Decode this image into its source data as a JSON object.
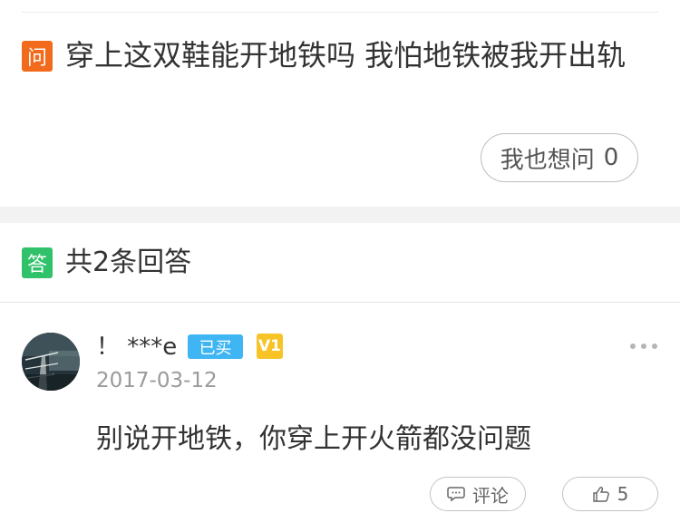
{
  "question": {
    "badge": "问",
    "text": "穿上这双鞋能开地铁吗 我怕地铁被我开出轨",
    "ask_label": "我也想问",
    "ask_count": "0"
  },
  "answers_header": {
    "badge": "答",
    "count_text": "共2条回答"
  },
  "answer": {
    "username": "！ ***e",
    "bought_badge": "已买",
    "level_badge": "V1",
    "date": "2017-03-12",
    "text": "别说开地铁，你穿上开火箭都没问题",
    "comment_label": "评论",
    "like_count": "5"
  },
  "colors": {
    "question_badge": "#f26a1b",
    "answer_badge": "#2fc26a",
    "bought_badge": "#3fb6f3",
    "level_badge": "#f7c325"
  },
  "icons": [
    "more-dots-icon",
    "comment-icon",
    "thumbs-up-icon"
  ]
}
